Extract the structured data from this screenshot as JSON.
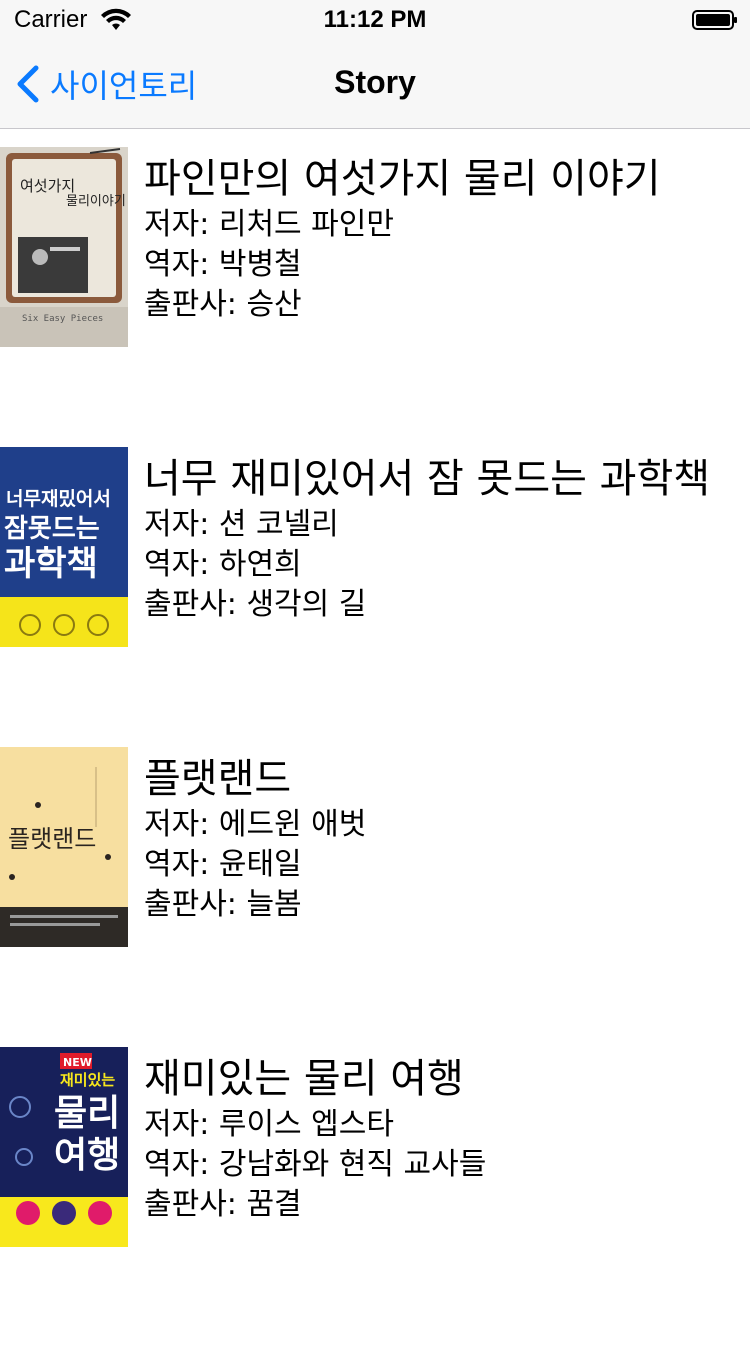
{
  "status_bar": {
    "carrier": "Carrier",
    "time": "11:12 PM",
    "icons": [
      "wifi-icon",
      "battery-icon"
    ]
  },
  "nav": {
    "back_label": "사이언토리",
    "title": "Story",
    "accent_color": "#0a7aff"
  },
  "books": [
    {
      "title": "파인만의 여섯가지 물리 이야기",
      "author": "저자: 리처드 파인만",
      "translator": "역자: 박병철",
      "publisher": "출판사: 승산",
      "cover": {
        "title_text": "여섯가지 물리이야기",
        "bg": "#d8d3c8",
        "accent": "#8a5a3a",
        "foot_text": "Six Easy Pieces"
      }
    },
    {
      "title": "너무 재미있어서 잠 못드는 과학책",
      "author": "저자: 션 코넬리",
      "translator": "역자: 하연희",
      "publisher": "출판사: 생각의 길",
      "cover": {
        "title_text": "너무 재미있어서 잠못드는 과학책",
        "bg": "#1f3f8a",
        "accent": "#f5e41a"
      }
    },
    {
      "title": "플랫랜드",
      "author": "저자: 에드윈 애벗",
      "translator": "역자: 윤태일",
      "publisher": "출판사: 늘봄",
      "cover": {
        "title_text": "플랫랜드",
        "bg": "#f7dfa0",
        "accent": "#2a2420"
      }
    },
    {
      "title": "재미있는 물리 여행",
      "author": "저자: 루이스 엡스타",
      "translator": "역자: 강남화와 현직 교사들",
      "publisher": "출판사: 꿈결",
      "cover": {
        "badge": "NEW",
        "title_text": "재미있는 물리 여행",
        "bg": "#17205a",
        "accent": "#f8e81c"
      }
    }
  ]
}
